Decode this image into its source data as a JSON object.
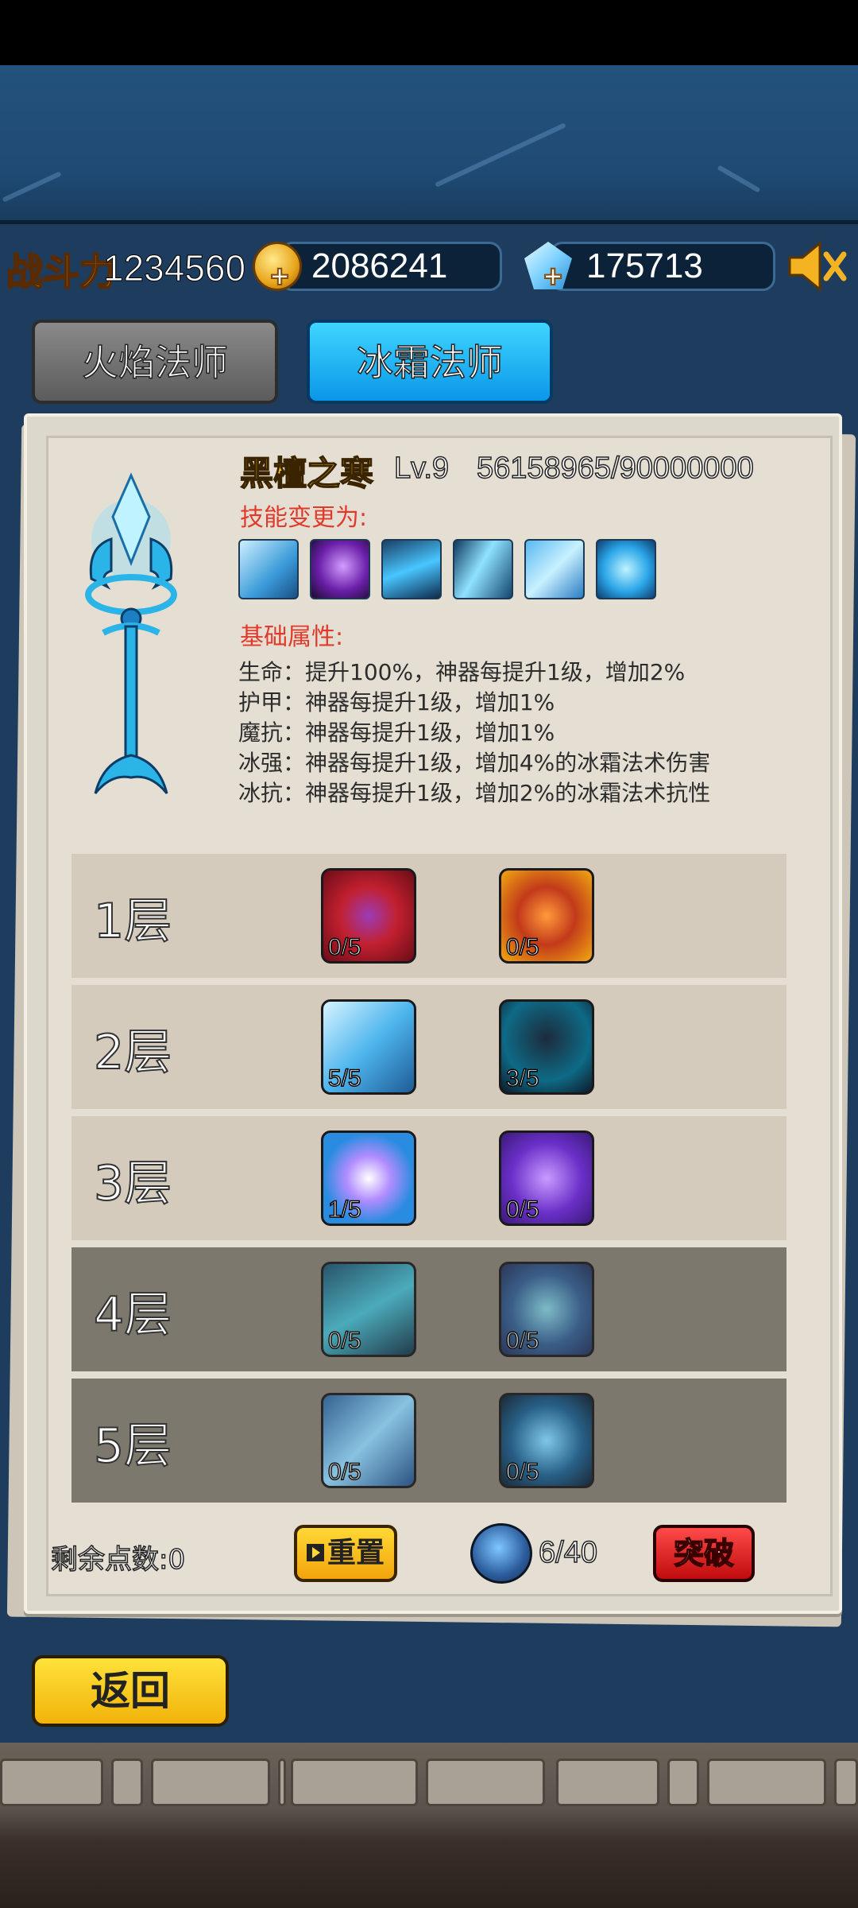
{
  "hud": {
    "power_label": "战斗力",
    "power_value": "1234560",
    "coins": "2086241",
    "gems": "175713"
  },
  "tabs": [
    {
      "label": "火焰法师",
      "active": false
    },
    {
      "label": "冰霜法师",
      "active": true
    }
  ],
  "artifact": {
    "name": "黑檀之寒",
    "level": "Lv.9",
    "exp": "56158965/90000000",
    "skill_heading": "技能变更为:",
    "attr_heading": "基础属性:",
    "attributes": [
      "生命：提升100%，神器每提升1级，增加2%",
      "护甲：神器每提升1级，增加1%",
      "魔抗：神器每提升1级，增加1%",
      "冰强：神器每提升1级，增加4%的冰霜法术伤害",
      "冰抗：神器每提升1级，增加2%的冰霜法术抗性"
    ]
  },
  "layers": [
    {
      "label": "1层",
      "unlocked": true,
      "talents": [
        {
          "icon": "ruby-ring-icon",
          "count": "0/5"
        },
        {
          "icon": "flame-shield-icon",
          "count": "0/5"
        }
      ]
    },
    {
      "label": "2层",
      "unlocked": true,
      "talents": [
        {
          "icon": "ice-shard-icon",
          "count": "5/5"
        },
        {
          "icon": "frost-ghost-icon",
          "count": "3/5"
        }
      ]
    },
    {
      "label": "3层",
      "unlocked": true,
      "talents": [
        {
          "icon": "ice-heart-icon",
          "count": "1/5"
        },
        {
          "icon": "spirit-twins-icon",
          "count": "0/5"
        }
      ]
    },
    {
      "label": "4层",
      "unlocked": false,
      "talents": [
        {
          "icon": "ice-wave-icon",
          "count": "0/5"
        },
        {
          "icon": "ice-fist-icon",
          "count": "0/5"
        }
      ]
    },
    {
      "label": "5层",
      "unlocked": false,
      "talents": [
        {
          "icon": "snowflake-storm-icon",
          "count": "0/5"
        },
        {
          "icon": "ice-burst-icon",
          "count": "0/5"
        }
      ]
    }
  ],
  "footer": {
    "remaining_points": "剩余点数:0",
    "reset_label": "重置",
    "stone_count": "6/40",
    "breakthrough_label": "突破"
  },
  "back_label": "返回"
}
